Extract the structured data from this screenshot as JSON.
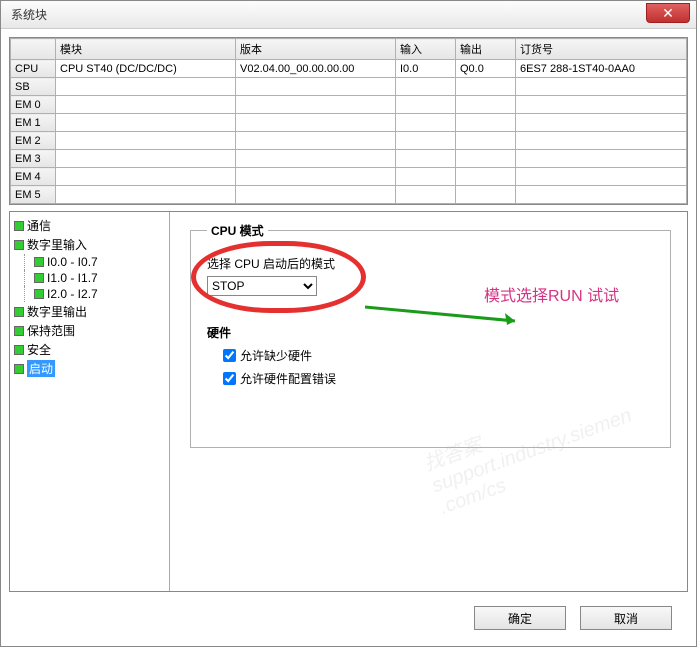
{
  "window": {
    "title": "系统块"
  },
  "table": {
    "headers": [
      "",
      "模块",
      "版本",
      "输入",
      "输出",
      "订货号"
    ],
    "row_labels": [
      "CPU",
      "SB",
      "EM 0",
      "EM 1",
      "EM 2",
      "EM 3",
      "EM 4",
      "EM 5"
    ],
    "rows": [
      {
        "module": "CPU ST40 (DC/DC/DC)",
        "version": "V02.04.00_00.00.00.00",
        "input": "I0.0",
        "output": "Q0.0",
        "order": "6ES7 288-1ST40-0AA0"
      },
      {
        "module": "",
        "version": "",
        "input": "",
        "output": "",
        "order": ""
      },
      {
        "module": "",
        "version": "",
        "input": "",
        "output": "",
        "order": ""
      },
      {
        "module": "",
        "version": "",
        "input": "",
        "output": "",
        "order": ""
      },
      {
        "module": "",
        "version": "",
        "input": "",
        "output": "",
        "order": ""
      },
      {
        "module": "",
        "version": "",
        "input": "",
        "output": "",
        "order": ""
      },
      {
        "module": "",
        "version": "",
        "input": "",
        "output": "",
        "order": ""
      },
      {
        "module": "",
        "version": "",
        "input": "",
        "output": "",
        "order": ""
      }
    ]
  },
  "tree": {
    "items": [
      {
        "label": "通信"
      },
      {
        "label": "数字里输入",
        "children": [
          "I0.0 - I0.7",
          "I1.0 - I1.7",
          "I2.0 - I2.7"
        ]
      },
      {
        "label": "数字里输出"
      },
      {
        "label": "保持范围"
      },
      {
        "label": "安全"
      },
      {
        "label": "启动",
        "selected": true
      }
    ]
  },
  "cpu_mode": {
    "legend": "CPU 模式",
    "mode_label": "选择 CPU 启动后的模式",
    "selected": "STOP",
    "hw_label": "硬件",
    "cb1": "允许缺少硬件",
    "cb2": "允许硬件配置错误"
  },
  "annotation": "模式选择RUN 试试",
  "buttons": {
    "ok": "确定",
    "cancel": "取消"
  },
  "watermark": "找答案\nsupport.industry.siemen\n.com/cs"
}
